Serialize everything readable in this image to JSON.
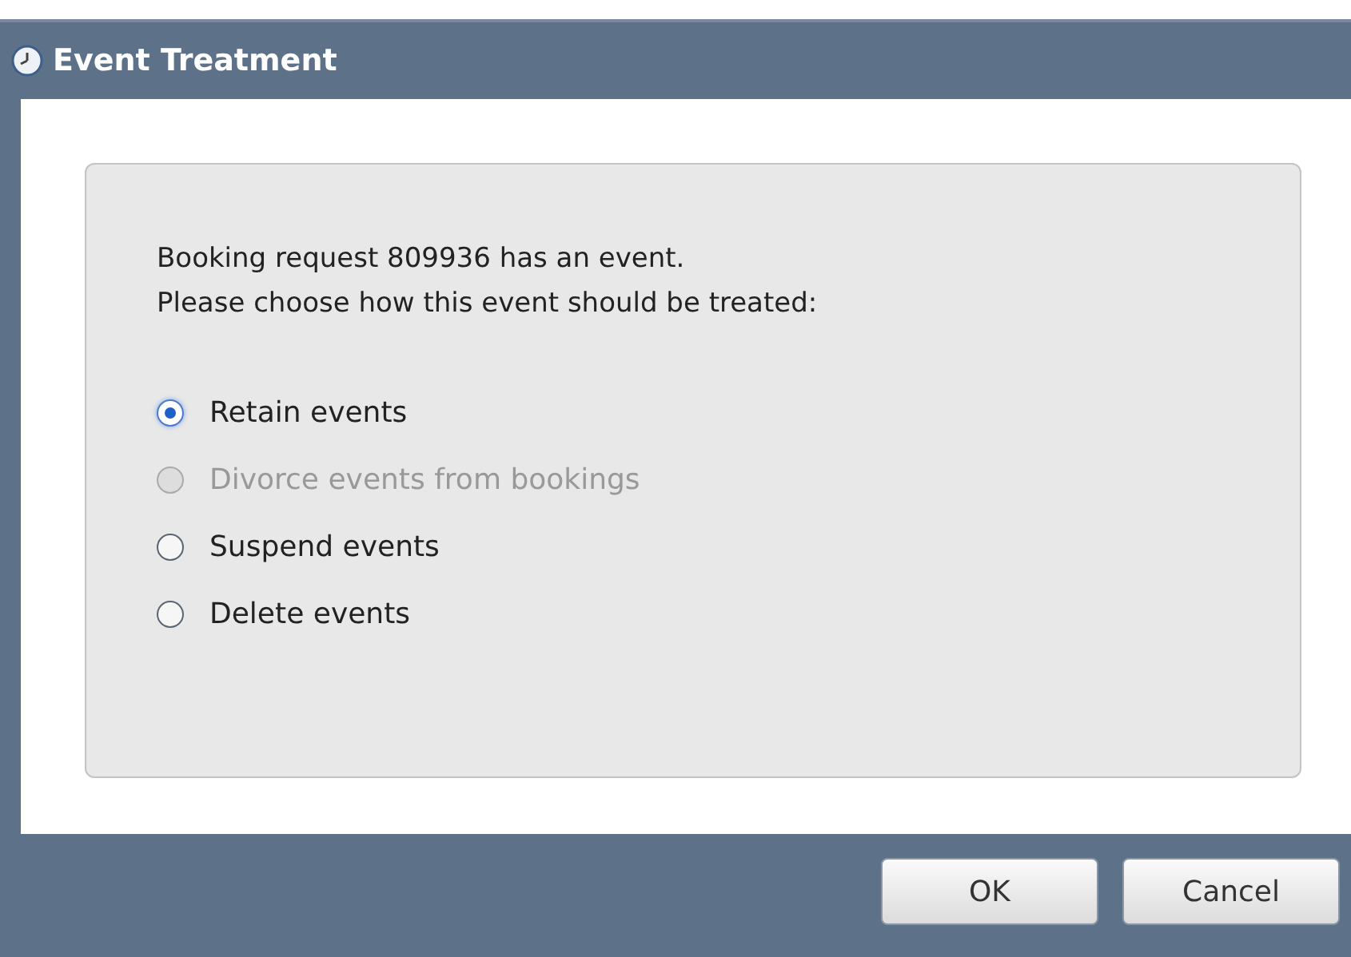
{
  "window": {
    "title": "Event Treatment"
  },
  "message": [
    "Booking request 809936 has an event.",
    "Please choose how this event should be treated:"
  ],
  "options": [
    {
      "label": "Retain events",
      "selected": true,
      "disabled": false
    },
    {
      "label": "Divorce events from bookings",
      "selected": false,
      "disabled": true
    },
    {
      "label": "Suspend events",
      "selected": false,
      "disabled": false
    },
    {
      "label": "Delete events",
      "selected": false,
      "disabled": false
    }
  ],
  "buttons": [
    "OK",
    "Cancel"
  ]
}
